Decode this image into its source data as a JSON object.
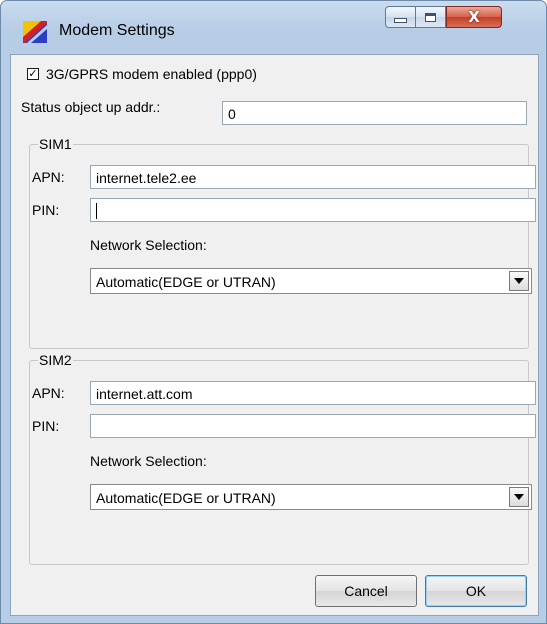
{
  "window": {
    "title": "Modem Settings",
    "icon": "modem-settings-app-icon",
    "controls": {
      "minimize_icon": "minimize-icon",
      "maximize_icon": "maximize-icon",
      "close_glyph": "X"
    }
  },
  "modem": {
    "enabled_label": "3G/GPRS modem enabled (ppp0)",
    "enabled_checked": true,
    "check_glyph": "✓",
    "status_addr_label": "Status object up addr.:",
    "status_addr_value": "0"
  },
  "sim1": {
    "label": "SIM1",
    "apn_label": "APN:",
    "apn_value": "internet.tele2.ee",
    "pin_label": "PIN:",
    "pin_value": "",
    "network_label": "Network Selection:",
    "network_value": "Automatic(EDGE or UTRAN)"
  },
  "sim2": {
    "label": "SIM2",
    "apn_label": "APN:",
    "apn_value": "internet.att.com",
    "pin_label": "PIN:",
    "pin_value": "",
    "network_label": "Network Selection:",
    "network_value": "Automatic(EDGE or UTRAN)"
  },
  "buttons": {
    "cancel": "Cancel",
    "ok": "OK"
  },
  "colors": {
    "accent": "#3c7fb1",
    "close_button": "#c43f25",
    "frame": "#b7cde6"
  }
}
